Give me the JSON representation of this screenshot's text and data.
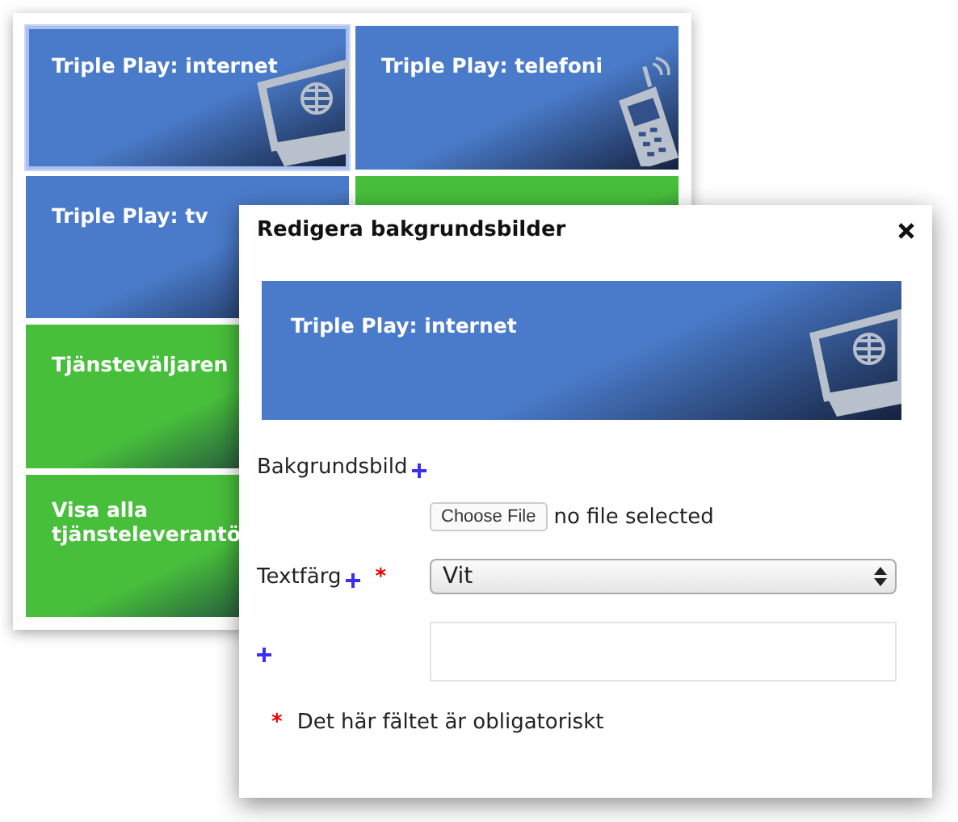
{
  "tiles": [
    {
      "label": "Triple Play: internet",
      "color": "#4a7bca",
      "kind": "monitor",
      "selected": true
    },
    {
      "label": "Triple Play: tv",
      "color": "#4a7bca",
      "kind": "plain",
      "selected": false
    },
    {
      "label": "Tjänsteväljaren",
      "color": "#47bf3b",
      "kind": "plain",
      "selected": false
    },
    {
      "label": "Visa alla tjänsteleverantö",
      "color": "#47bf3b",
      "kind": "plain",
      "selected": false
    },
    {
      "label": "Triple Play: telefoni",
      "color": "#4a7bca",
      "kind": "phone",
      "selected": false
    },
    {
      "color": "#47bf3b",
      "kind": "plain",
      "selected": false
    }
  ],
  "dialog": {
    "title": "Redigera bakgrundsbilder",
    "preview": {
      "label": "Triple Play: internet",
      "color": "#4a7bca",
      "kind": "monitor"
    },
    "fields": [
      {
        "kind": "file",
        "label": "Bakgrundsbild",
        "button": "Choose File",
        "value": "no file selected"
      },
      {
        "kind": "select",
        "label": "Textfärg",
        "required_mark": "*",
        "value": "Vit"
      },
      {
        "kind": "text"
      }
    ],
    "footnote": {
      "mark": "*",
      "text": "Det här fältet är obligatoriskt"
    }
  }
}
